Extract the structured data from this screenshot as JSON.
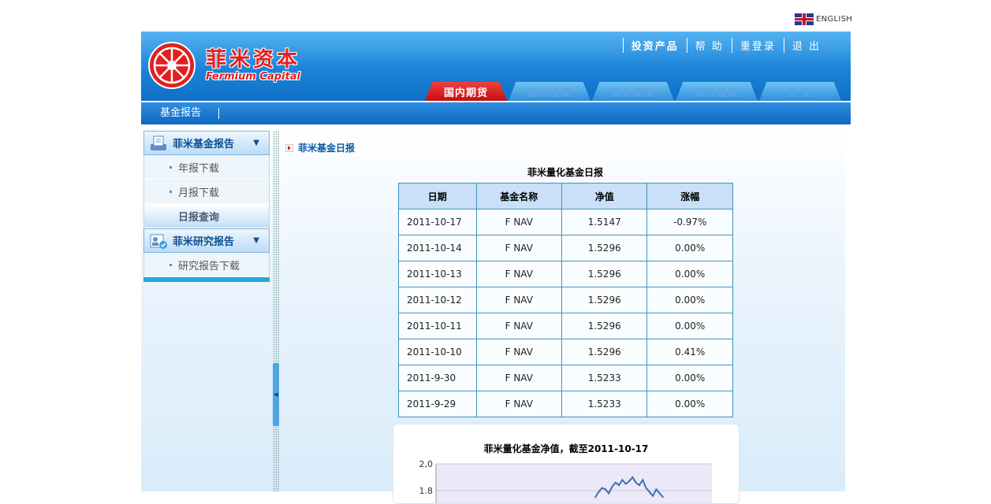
{
  "lang": {
    "label": "ENGLISH"
  },
  "logo": {
    "cn": "菲米资本",
    "en": "Fermium Capital"
  },
  "top_menu": [
    "投资产品",
    "帮 助",
    "重登录",
    "退 出"
  ],
  "tabs": [
    {
      "label": "国内期货",
      "active": true
    },
    {
      "label": "国内股票",
      "active": false
    },
    {
      "label": "海外期货",
      "active": false
    },
    {
      "label": "海外股票",
      "active": false
    },
    {
      "label": "外 汇",
      "active": false
    }
  ],
  "subnav": {
    "item": "基金报告"
  },
  "sidebar": {
    "sections": [
      {
        "title": "菲米基金报告",
        "items": [
          "年报下载",
          "月报下载",
          "日报查询"
        ],
        "active_item": "日报查询"
      },
      {
        "title": "菲米研究报告",
        "items": [
          "研究报告下载"
        ]
      }
    ]
  },
  "main": {
    "section_title": "菲米基金日报",
    "table_title": "菲米量化基金日报",
    "columns": [
      "日期",
      "基金名称",
      "净值",
      "涨幅"
    ],
    "rows": [
      [
        "2011-10-17",
        "F NAV",
        "1.5147",
        "-0.97%"
      ],
      [
        "2011-10-14",
        "F NAV",
        "1.5296",
        "0.00%"
      ],
      [
        "2011-10-13",
        "F NAV",
        "1.5296",
        "0.00%"
      ],
      [
        "2011-10-12",
        "F NAV",
        "1.5296",
        "0.00%"
      ],
      [
        "2011-10-11",
        "F NAV",
        "1.5296",
        "0.00%"
      ],
      [
        "2011-10-10",
        "F NAV",
        "1.5296",
        "0.41%"
      ],
      [
        "2011-9-30",
        "F NAV",
        "1.5233",
        "0.00%"
      ],
      [
        "2011-9-29",
        "F NAV",
        "1.5233",
        "0.00%"
      ]
    ],
    "chart_title": "菲米量化基金净值，截至2011-10-17"
  },
  "chart_data": {
    "type": "line",
    "title": "菲米量化基金净值，截至2011-10-17",
    "ytick_labels": [
      "2,0",
      "1.8"
    ],
    "ylim": [
      1.8,
      2.0
    ],
    "grid": true,
    "x": [
      0,
      1,
      2,
      3,
      4,
      5,
      6,
      7,
      8,
      9,
      10,
      11,
      12,
      13,
      14,
      15,
      16,
      17,
      18,
      19,
      20
    ],
    "values": [
      1.75,
      1.79,
      1.82,
      1.81,
      1.78,
      1.83,
      1.86,
      1.84,
      1.88,
      1.85,
      1.87,
      1.9,
      1.86,
      1.84,
      1.88,
      1.82,
      1.79,
      1.76,
      1.81,
      1.78,
      1.75
    ]
  }
}
